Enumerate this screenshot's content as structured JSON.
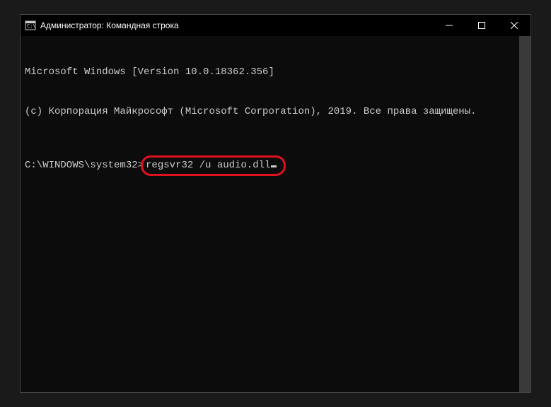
{
  "window": {
    "title": "Администратор: Командная строка"
  },
  "terminal": {
    "line1": "Microsoft Windows [Version 10.0.18362.356]",
    "line2": "(c) Корпорация Майкрософт (Microsoft Corporation), 2019. Все права защищены.",
    "prompt": "C:\\WINDOWS\\system32>",
    "command": "regsvr32 /u audio.dll"
  }
}
